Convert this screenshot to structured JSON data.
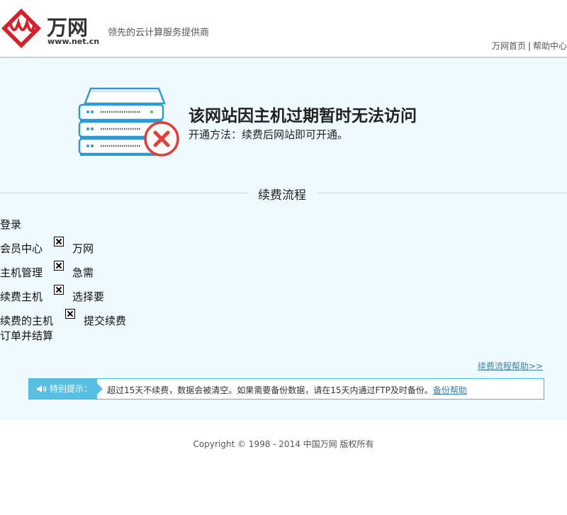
{
  "header": {
    "logo_text": "万网",
    "logo_url_text": "www.net.cn",
    "slogan": "领先的云计算服务提供商",
    "links": [
      "万网首页",
      "帮助中心"
    ],
    "separator": "|"
  },
  "notice": {
    "headline": "该网站因主机过期暂时无法访问",
    "method": "开通方法：续费后网站即可开通。",
    "icon": "server-error-icon"
  },
  "process": {
    "title": "续费流程",
    "steps": [
      {
        "text": "登录"
      },
      {
        "text": "会员中心"
      },
      {
        "text": "万网"
      },
      {
        "text": "主机管理"
      },
      {
        "text": "急需"
      },
      {
        "text": "续费主机"
      },
      {
        "text": "选择要"
      },
      {
        "text": "续费的主机"
      },
      {
        "text": "订单并结算"
      },
      {
        "text": "提交续费"
      }
    ],
    "help_link": "续费流程帮助>>"
  },
  "tip": {
    "label": "特别提示：",
    "text": "超过15天不续费，数据会被清空。如果需要备份数据，请在15天内通过FTP及时备份。",
    "link": "备份帮助"
  },
  "footer": {
    "copyright": "Copyright © 1998 - 2014 中国万网 版权所有"
  },
  "colors": {
    "brand_red": "#d7212a",
    "band_bg": "#eefafe",
    "accent_blue": "#58bfe2",
    "link_blue": "#3d7fb0"
  }
}
